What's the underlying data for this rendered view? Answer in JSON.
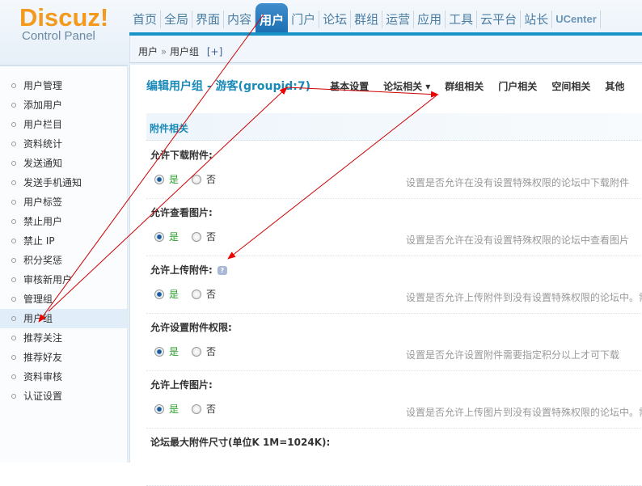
{
  "logo": {
    "brand": "Discuz!",
    "subtitle": "Control Panel"
  },
  "topnav": [
    "首页",
    "全局",
    "界面",
    "内容",
    "用户",
    "门户",
    "论坛",
    "群组",
    "运营",
    "应用",
    "工具",
    "云平台",
    "站长",
    "UCenter"
  ],
  "breadcrumb": {
    "root": "用户",
    "sep": "»",
    "current": "用户组",
    "add": "[+]"
  },
  "sidebar": [
    "用户管理",
    "添加用户",
    "用户栏目",
    "资料统计",
    "发送通知",
    "发送手机通知",
    "用户标签",
    "禁止用户",
    "禁止 IP",
    "积分奖惩",
    "审核新用户",
    "管理组",
    "用户组",
    "推荐关注",
    "推荐好友",
    "资料审核",
    "认证设置"
  ],
  "title": "编辑用户组 - 游客(groupid:7)",
  "subtabs": [
    "基本设置",
    "论坛相关 ▾",
    "群组相关",
    "门户相关",
    "空间相关",
    "其他"
  ],
  "section": "附件相关",
  "options": {
    "yes": "是",
    "no": "否"
  },
  "rows": [
    {
      "label": "允许下载附件:",
      "desc": "设置是否允许在没有设置特殊权限的论坛中下载附件"
    },
    {
      "label": "允许查看图片:",
      "desc": "设置是否允许在没有设置特殊权限的论坛中查看图片"
    },
    {
      "label": "允许上传附件:",
      "desc": "设置是否允许上传附件到没有设置特殊权限的论坛中。需"
    },
    {
      "label": "允许设置附件权限:",
      "desc": "设置是否允许设置附件需要指定积分以上才可下载"
    },
    {
      "label": "允许上传图片:",
      "desc": "设置是否允许上传图片到没有设置特殊权限的论坛中。需"
    },
    {
      "label": "论坛最大附件尺寸(单位K 1M=1024K):",
      "desc": ""
    }
  ],
  "help_icon": "?"
}
